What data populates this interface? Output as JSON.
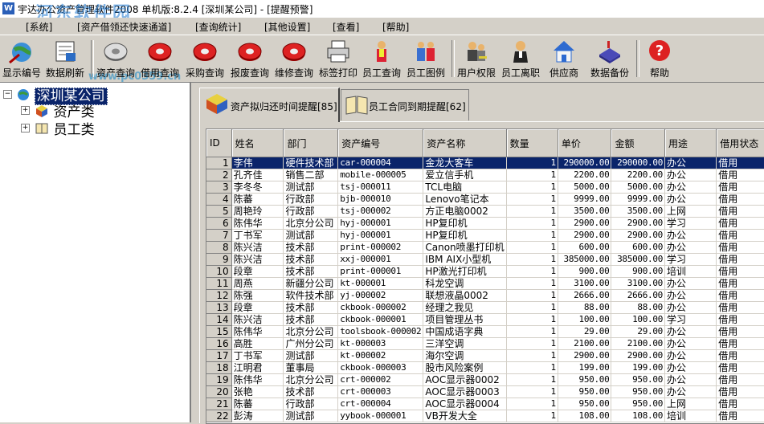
{
  "window": {
    "title": "宇达办公资产管理软件2008 单机版:8.2.4 [深圳某公司] - [提醒预警]"
  },
  "watermark": {
    "main": "河东软件园",
    "url": "www.pc0359.cn"
  },
  "menu": [
    "[系统]",
    "[资产借领还快速通道]",
    "[查询统计]",
    "[其他设置]",
    "[查看]",
    "[帮助]"
  ],
  "toolbar": {
    "show_code": "显示编号",
    "refresh": "数据刷新",
    "asset_query": "资产查询",
    "borrow_query": "借用查询",
    "purchase_query": "采购查询",
    "scrap_query": "报废查询",
    "repair_query": "维修查询",
    "label_print": "标签打印",
    "staff_query": "员工查询",
    "staff_chart": "员工图例",
    "user_rights": "用户权限",
    "staff_leave": "员工离职",
    "supplier": "供应商",
    "data_backup": "数据备份",
    "help": "帮助"
  },
  "tree": {
    "root": "深圳某公司",
    "children": [
      "资产类",
      "员工类"
    ]
  },
  "tabs": [
    {
      "label": "资产拟归还时间提醒[85]"
    },
    {
      "label": "员工合同到期提醒[62]"
    }
  ],
  "grid": {
    "columns": [
      "ID",
      "姓名",
      "部门",
      "资产编号",
      "资产名称",
      "数量",
      "单价",
      "金额",
      "用途",
      "借用状态"
    ],
    "selected_row": 1,
    "rows": [
      [
        "1",
        "李伟",
        "硬件技术部",
        "car-000004",
        "金龙大客车",
        "1",
        "290000.00",
        "290000.00",
        "办公",
        "借用"
      ],
      [
        "2",
        "孔齐佳",
        "销售二部",
        "mobile-000005",
        "爱立信手机",
        "1",
        "2200.00",
        "2200.00",
        "办公",
        "借用"
      ],
      [
        "3",
        "李冬冬",
        "测试部",
        "tsj-000011",
        "TCL电脑",
        "1",
        "5000.00",
        "5000.00",
        "办公",
        "借用"
      ],
      [
        "4",
        "陈蕃",
        "行政部",
        "bjb-000010",
        "Lenovo笔记本",
        "1",
        "9999.00",
        "9999.00",
        "办公",
        "借用"
      ],
      [
        "5",
        "周艳玲",
        "行政部",
        "tsj-000002",
        "方正电脑0002",
        "1",
        "3500.00",
        "3500.00",
        "上网",
        "借用"
      ],
      [
        "6",
        "陈伟华",
        "北京分公司",
        "hyj-000001",
        "HP复印机",
        "1",
        "2900.00",
        "2900.00",
        "学习",
        "借用"
      ],
      [
        "7",
        "丁书军",
        "测试部",
        "hyj-000001",
        "HP复印机",
        "1",
        "2900.00",
        "2900.00",
        "办公",
        "借用"
      ],
      [
        "8",
        "陈兴洁",
        "技术部",
        "print-000002",
        "Canon喷墨打印机",
        "1",
        "600.00",
        "600.00",
        "办公",
        "借用"
      ],
      [
        "9",
        "陈兴洁",
        "技术部",
        "xxj-000001",
        "IBM AIX小型机",
        "1",
        "385000.00",
        "385000.00",
        "学习",
        "借用"
      ],
      [
        "10",
        "段章",
        "技术部",
        "print-000001",
        "HP激光打印机",
        "1",
        "900.00",
        "900.00",
        "培训",
        "借用"
      ],
      [
        "11",
        "周燕",
        "新疆分公司",
        "kt-000001",
        "科龙空调",
        "1",
        "3100.00",
        "3100.00",
        "办公",
        "借用"
      ],
      [
        "12",
        "陈强",
        "软件技术部",
        "yj-000002",
        "联想液晶0002",
        "1",
        "2666.00",
        "2666.00",
        "办公",
        "借用"
      ],
      [
        "13",
        "段章",
        "技术部",
        "ckbook-000002",
        "经理之我见",
        "1",
        "88.00",
        "88.00",
        "办公",
        "借用"
      ],
      [
        "14",
        "陈兴洁",
        "技术部",
        "ckbook-000001",
        "项目管理丛书",
        "1",
        "100.00",
        "100.00",
        "学习",
        "借用"
      ],
      [
        "15",
        "陈伟华",
        "北京分公司",
        "toolsbook-000002",
        "中国成语字典",
        "1",
        "29.00",
        "29.00",
        "办公",
        "借用"
      ],
      [
        "16",
        "高胜",
        "广州分公司",
        "kt-000003",
        "三洋空调",
        "1",
        "2100.00",
        "2100.00",
        "办公",
        "借用"
      ],
      [
        "17",
        "丁书军",
        "测试部",
        "kt-000002",
        "海尔空调",
        "1",
        "2900.00",
        "2900.00",
        "办公",
        "借用"
      ],
      [
        "18",
        "江明君",
        "董事局",
        "ckbook-000003",
        "股市风险案例",
        "1",
        "199.00",
        "199.00",
        "办公",
        "借用"
      ],
      [
        "19",
        "陈伟华",
        "北京分公司",
        "crt-000002",
        "AOC显示器0002",
        "1",
        "950.00",
        "950.00",
        "办公",
        "借用"
      ],
      [
        "20",
        "张艳",
        "技术部",
        "crt-000003",
        "AOC显示器0003",
        "1",
        "950.00",
        "950.00",
        "办公",
        "借用"
      ],
      [
        "21",
        "陈蕃",
        "行政部",
        "crt-000004",
        "AOC显示器0004",
        "1",
        "950.00",
        "950.00",
        "上网",
        "借用"
      ],
      [
        "22",
        "彭涛",
        "测试部",
        "yybook-000001",
        "VB开发大全",
        "1",
        "108.00",
        "108.00",
        "培训",
        "借用"
      ]
    ]
  },
  "colors": {
    "selection": "#0a246a",
    "face": "#d4d0c8",
    "watermark": "#1e78d2"
  }
}
